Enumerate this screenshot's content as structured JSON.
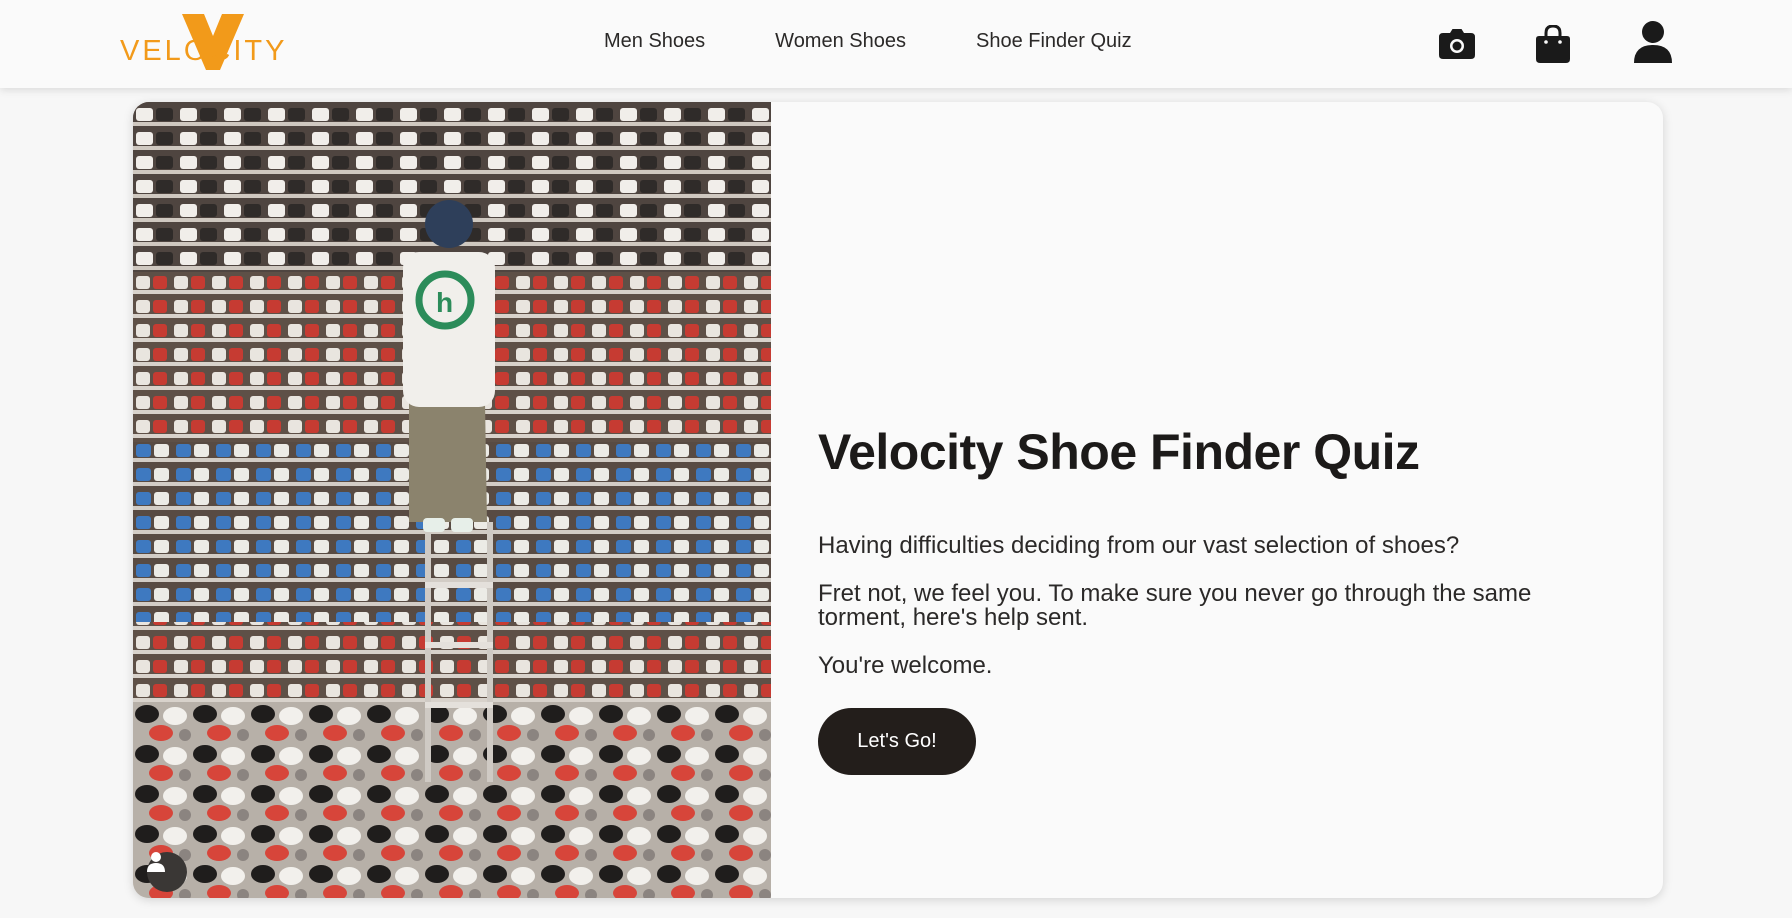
{
  "header": {
    "logo_text": "VELOCITY",
    "nav": [
      {
        "label": "Men Shoes"
      },
      {
        "label": "Women Shoes"
      },
      {
        "label": "Shoe Finder Quiz"
      }
    ],
    "icons": [
      "camera-icon",
      "shopping-bag-icon",
      "user-icon"
    ]
  },
  "hero": {
    "image": "person on a ladder in a room filled with shelves of sneakers",
    "title": "Velocity Shoe Finder Quiz",
    "paragraphs": [
      "Having difficulties deciding from our vast selection of shoes?",
      "Fret not, we feel you. To make sure you never go through the same torment, here's help sent.",
      "You're welcome."
    ],
    "cta_label": "Let's Go!"
  },
  "colors": {
    "brand_orange": "#f29a1a",
    "dark": "#231e1b",
    "background": "#f7f7f7"
  }
}
